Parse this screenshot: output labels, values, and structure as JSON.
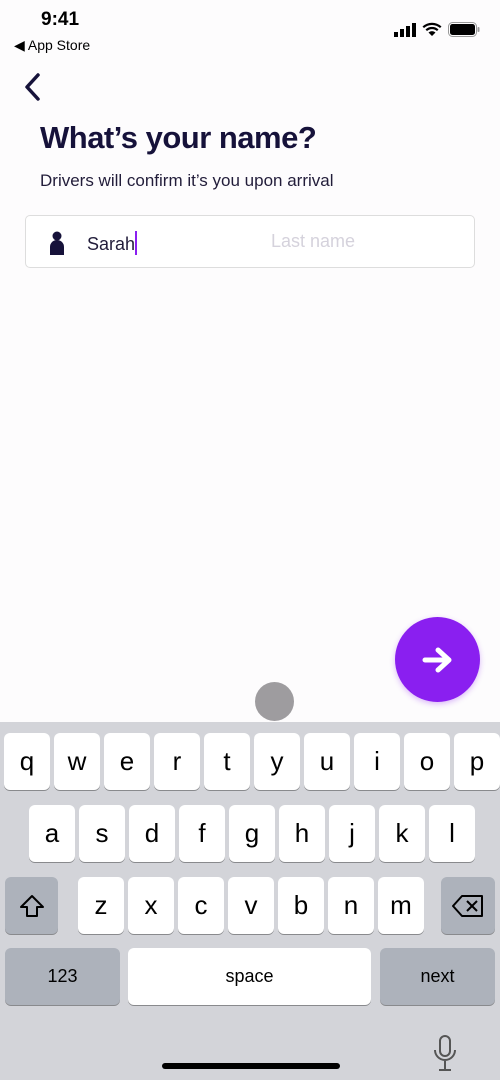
{
  "status": {
    "time": "9:41",
    "back_app": "◀ App Store"
  },
  "header": {
    "title": "What’s your name?",
    "subtitle": "Drivers will confirm it’s you upon arrival"
  },
  "name_field": {
    "first_value": "Sarah",
    "last_placeholder": "Last name"
  },
  "colors": {
    "accent": "#8a1ff0",
    "text": "#16123a"
  },
  "keyboard": {
    "row1": [
      "q",
      "w",
      "e",
      "r",
      "t",
      "y",
      "u",
      "i",
      "o",
      "p"
    ],
    "row2": [
      "a",
      "s",
      "d",
      "f",
      "g",
      "h",
      "j",
      "k",
      "l"
    ],
    "row3": [
      "z",
      "x",
      "c",
      "v",
      "b",
      "n",
      "m"
    ],
    "numbers_label": "123",
    "space_label": "space",
    "return_label": "next"
  }
}
